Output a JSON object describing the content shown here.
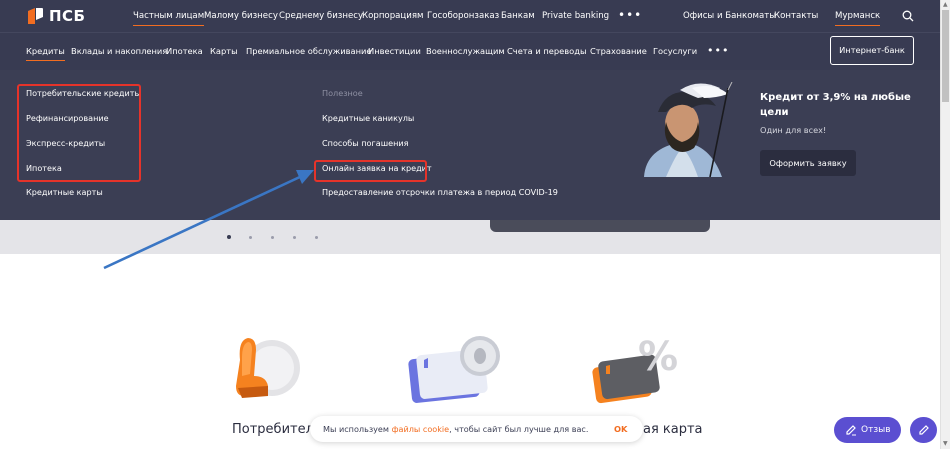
{
  "brand": {
    "name": "ПСБ"
  },
  "topnav": {
    "items": [
      {
        "label": "Частным лицам",
        "active": true
      },
      {
        "label": "Малому бизнесу"
      },
      {
        "label": "Среднему бизнесу"
      },
      {
        "label": "Корпорациям"
      },
      {
        "label": "Гособоронзаказ"
      },
      {
        "label": "Банкам"
      },
      {
        "label": "Private banking"
      }
    ],
    "more": "•••",
    "offices": "Офисы и Банкоматы",
    "contacts": "Контакты",
    "city": "Мурманск"
  },
  "menubar": {
    "items": [
      {
        "label": "Кредиты",
        "active": true
      },
      {
        "label": "Вклады и накопления"
      },
      {
        "label": "Ипотека"
      },
      {
        "label": "Карты"
      },
      {
        "label": "Премиальное обслуживание"
      },
      {
        "label": "Инвестиции"
      },
      {
        "label": "Военнослужащим"
      },
      {
        "label": "Счета и переводы"
      },
      {
        "label": "Страхование"
      },
      {
        "label": "Госуслуги"
      }
    ],
    "more": "•••",
    "internet_bank": "Интернет-банк"
  },
  "dropdown": {
    "col1": [
      "Потребительские кредиты",
      "Рефинансирование",
      "Экспресс-кредиты",
      "Ипотека",
      "Кредитные карты"
    ],
    "col2_heading": "Полезное",
    "col2": [
      "Кредитные каникулы",
      "Способы погашения",
      "Онлайн заявка на кредит",
      "Предоставление отсрочки платежа в период COVID-19"
    ],
    "promo": {
      "title": "Кредит от 3,9% на любые цели",
      "subtitle": "Один для всех!",
      "button": "Оформить заявку"
    }
  },
  "products": [
    {
      "title": "Потребитель"
    },
    {
      "title": "ая карта"
    }
  ],
  "cookie": {
    "text_before": "Мы используем ",
    "link": "файлы cookie",
    "text_after": ", чтобы сайт был лучше для вас.",
    "ok": "OK"
  },
  "review_button": "Отзыв",
  "colors": {
    "header_bg": "#383b52",
    "accent": "#f26d21",
    "highlight": "#e5332a",
    "arrow": "#3a76c4",
    "review": "#5b4fd1"
  }
}
